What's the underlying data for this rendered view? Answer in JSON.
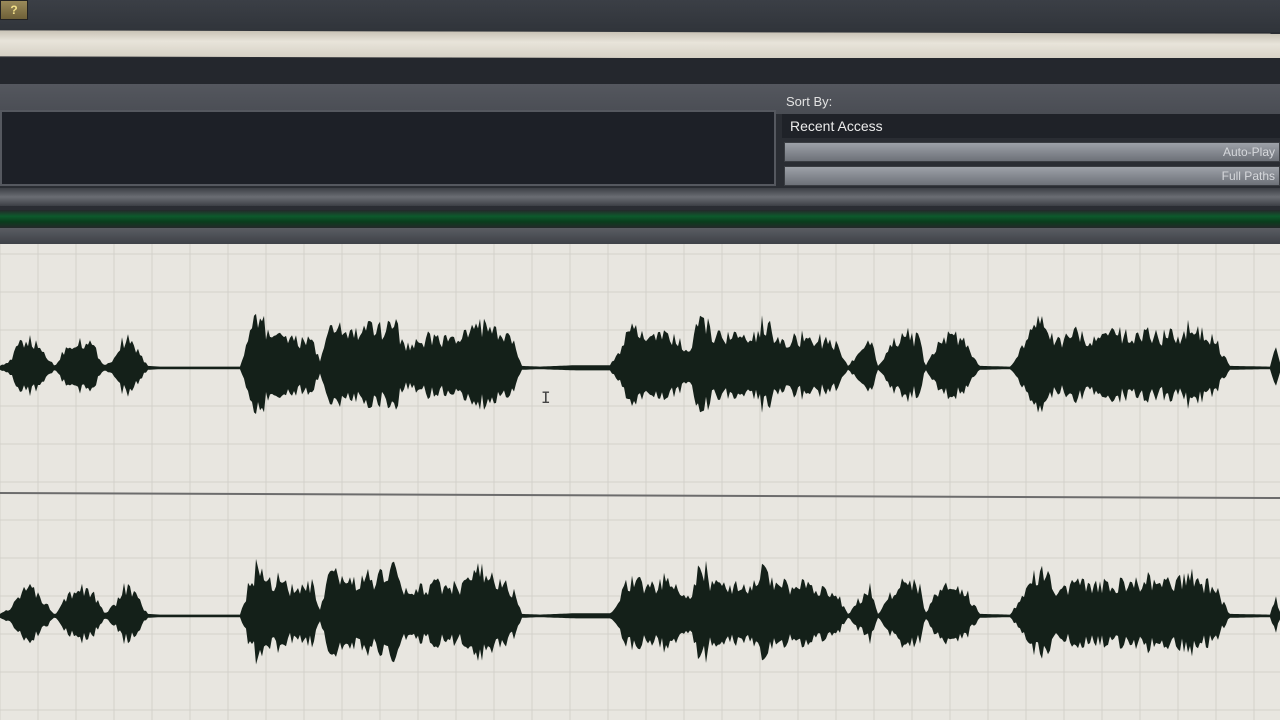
{
  "toolbar": {
    "help_icon": "?"
  },
  "sort_panel": {
    "sort_by_label": "Sort By:",
    "sort_value": "Recent Access",
    "auto_play_label": "Auto-Play",
    "full_paths_label": "Full Paths"
  },
  "icons": {
    "help": "help-icon",
    "cursor": "text-cursor-icon"
  },
  "colors": {
    "waveform": "#142019",
    "grid_bg": "#e8e6e0",
    "grid_line": "#d3d1ca",
    "progress": "#0d5a2c"
  },
  "tracks": [
    {
      "name": "channel-left"
    },
    {
      "name": "channel-right"
    }
  ],
  "waveform": {
    "envelope": [
      [
        0,
        0.03
      ],
      [
        10,
        0.12
      ],
      [
        20,
        0.45
      ],
      [
        28,
        0.5
      ],
      [
        40,
        0.35
      ],
      [
        55,
        0.03
      ],
      [
        65,
        0.35
      ],
      [
        78,
        0.5
      ],
      [
        92,
        0.42
      ],
      [
        105,
        0.03
      ],
      [
        115,
        0.2
      ],
      [
        125,
        0.55
      ],
      [
        135,
        0.38
      ],
      [
        148,
        0.03
      ],
      [
        160,
        0.02
      ],
      [
        240,
        0.02
      ],
      [
        250,
        0.6
      ],
      [
        258,
        0.9
      ],
      [
        265,
        0.75
      ],
      [
        272,
        0.55
      ],
      [
        280,
        0.7
      ],
      [
        290,
        0.5
      ],
      [
        300,
        0.45
      ],
      [
        312,
        0.55
      ],
      [
        320,
        0.1
      ],
      [
        328,
        0.6
      ],
      [
        335,
        0.75
      ],
      [
        345,
        0.65
      ],
      [
        355,
        0.6
      ],
      [
        368,
        0.7
      ],
      [
        378,
        0.65
      ],
      [
        388,
        0.8
      ],
      [
        395,
        0.9
      ],
      [
        400,
        0.55
      ],
      [
        410,
        0.35
      ],
      [
        420,
        0.5
      ],
      [
        435,
        0.55
      ],
      [
        450,
        0.5
      ],
      [
        462,
        0.55
      ],
      [
        470,
        0.6
      ],
      [
        478,
        0.85
      ],
      [
        486,
        0.7
      ],
      [
        495,
        0.6
      ],
      [
        505,
        0.55
      ],
      [
        515,
        0.4
      ],
      [
        522,
        0.03
      ],
      [
        540,
        0.02
      ],
      [
        575,
        0.04
      ],
      [
        610,
        0.04
      ],
      [
        625,
        0.5
      ],
      [
        635,
        0.7
      ],
      [
        645,
        0.55
      ],
      [
        655,
        0.5
      ],
      [
        665,
        0.65
      ],
      [
        675,
        0.5
      ],
      [
        690,
        0.3
      ],
      [
        698,
        0.75
      ],
      [
        705,
        0.85
      ],
      [
        712,
        0.55
      ],
      [
        725,
        0.6
      ],
      [
        740,
        0.5
      ],
      [
        755,
        0.55
      ],
      [
        765,
        0.85
      ],
      [
        775,
        0.6
      ],
      [
        790,
        0.5
      ],
      [
        805,
        0.55
      ],
      [
        820,
        0.5
      ],
      [
        835,
        0.45
      ],
      [
        848,
        0.03
      ],
      [
        862,
        0.35
      ],
      [
        870,
        0.55
      ],
      [
        878,
        0.03
      ],
      [
        890,
        0.4
      ],
      [
        905,
        0.6
      ],
      [
        920,
        0.5
      ],
      [
        925,
        0.03
      ],
      [
        937,
        0.4
      ],
      [
        950,
        0.6
      ],
      [
        965,
        0.45
      ],
      [
        980,
        0.03
      ],
      [
        1010,
        0.02
      ],
      [
        1025,
        0.45
      ],
      [
        1040,
        0.85
      ],
      [
        1050,
        0.6
      ],
      [
        1060,
        0.45
      ],
      [
        1075,
        0.6
      ],
      [
        1090,
        0.5
      ],
      [
        1105,
        0.55
      ],
      [
        1120,
        0.6
      ],
      [
        1135,
        0.55
      ],
      [
        1150,
        0.65
      ],
      [
        1165,
        0.55
      ],
      [
        1180,
        0.6
      ],
      [
        1190,
        0.75
      ],
      [
        1200,
        0.6
      ],
      [
        1215,
        0.5
      ],
      [
        1230,
        0.03
      ],
      [
        1270,
        0.02
      ],
      [
        1276,
        0.35
      ],
      [
        1280,
        0.1
      ]
    ]
  }
}
